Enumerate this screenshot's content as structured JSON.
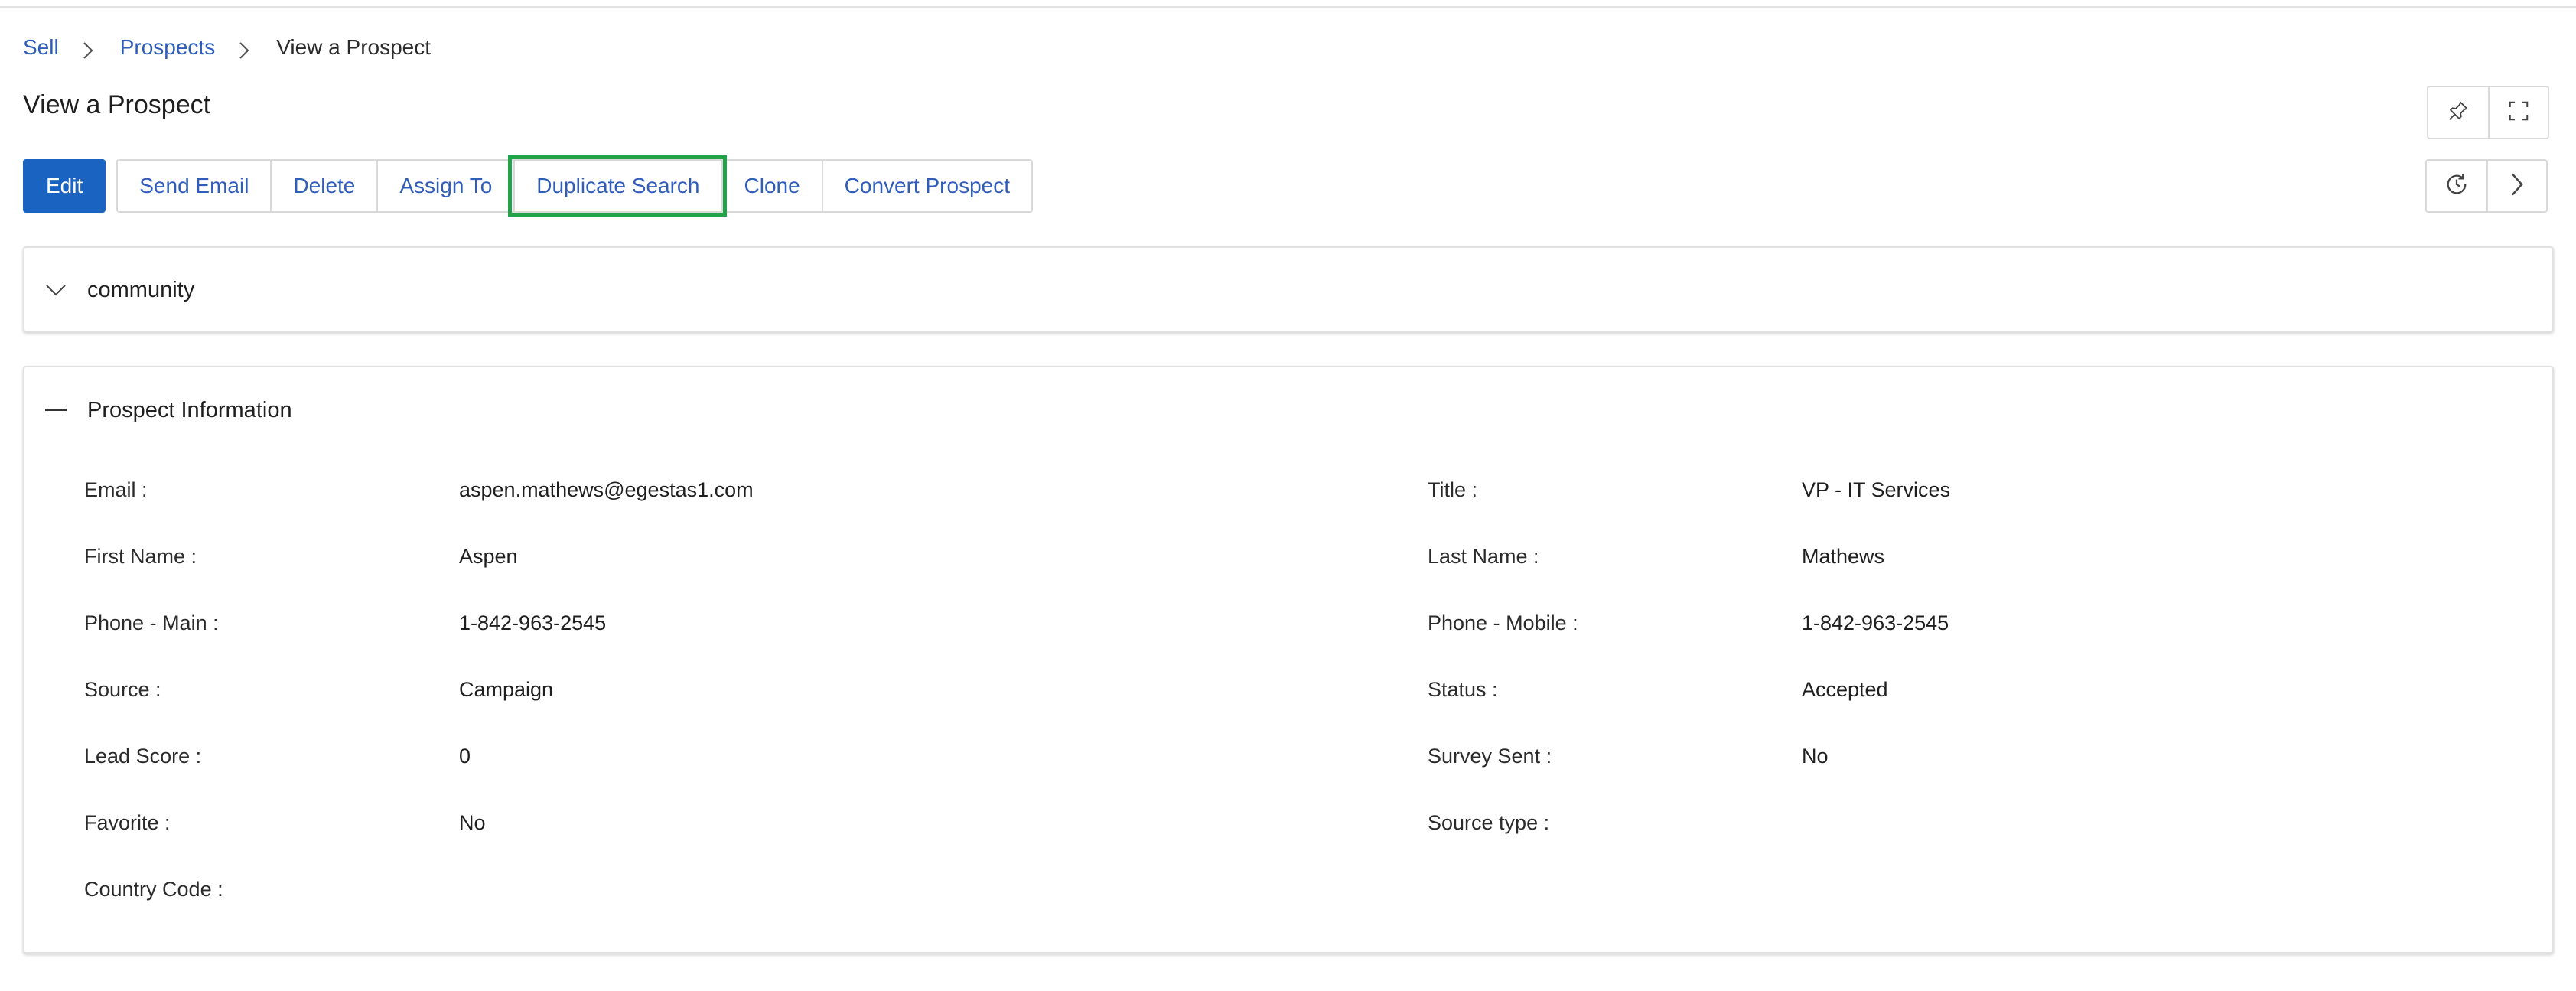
{
  "breadcrumb": {
    "items": [
      "Sell",
      "Prospects",
      "View a Prospect"
    ]
  },
  "page": {
    "title": "View a Prospect"
  },
  "toolbar": {
    "edit": "Edit",
    "send_email": "Send Email",
    "delete": "Delete",
    "assign_to": "Assign To",
    "duplicate_search": "Duplicate Search",
    "clone": "Clone",
    "convert_prospect": "Convert Prospect"
  },
  "icons": {
    "pin": "pin-icon",
    "expand": "expand-icon",
    "history": "history-icon",
    "next": "chevron-right-icon"
  },
  "colors": {
    "primary": "#1a63c1",
    "link": "#2f5db8",
    "highlight": "#22a34a"
  },
  "panels": {
    "community": {
      "title": "community"
    },
    "info": {
      "title": "Prospect Information"
    }
  },
  "fields": {
    "left": [
      {
        "label": "Email :",
        "value": "aspen.mathews@egestas1.com"
      },
      {
        "label": "First Name :",
        "value": "Aspen"
      },
      {
        "label": "Phone - Main :",
        "value": "1-842-963-2545"
      },
      {
        "label": "Source :",
        "value": "Campaign"
      },
      {
        "label": "Lead Score :",
        "value": "0"
      },
      {
        "label": "Favorite :",
        "value": "No"
      },
      {
        "label": "Country Code :",
        "value": ""
      }
    ],
    "right": [
      {
        "label": "Title :",
        "value": "VP - IT Services"
      },
      {
        "label": "Last Name :",
        "value": "Mathews"
      },
      {
        "label": "Phone - Mobile :",
        "value": "1-842-963-2545"
      },
      {
        "label": "Status :",
        "value": "Accepted"
      },
      {
        "label": "Survey Sent :",
        "value": "No"
      },
      {
        "label": "Source type :",
        "value": ""
      }
    ]
  }
}
